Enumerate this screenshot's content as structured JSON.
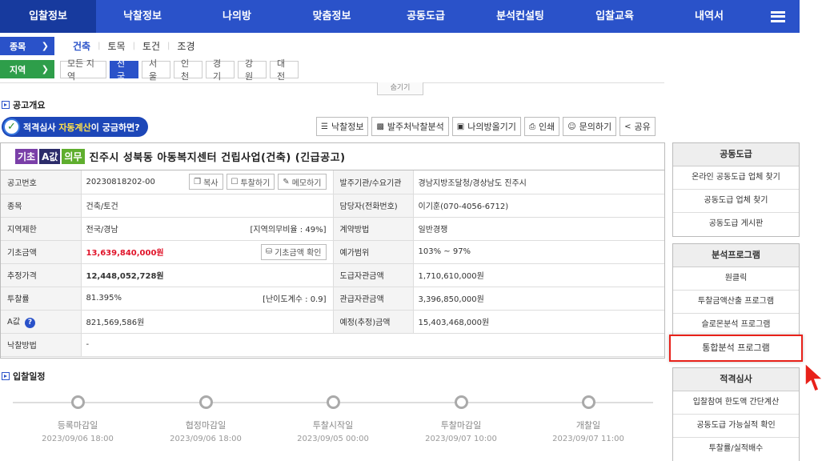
{
  "nav": {
    "items": [
      "입찰정보",
      "낙찰정보",
      "나의방",
      "맞춤정보",
      "공동도급",
      "분석컨설팅",
      "입찰교육",
      "내역서"
    ],
    "menu_icon": "hamburger-icon"
  },
  "filters": {
    "category_label": "종목",
    "categories": [
      "건축",
      "토목",
      "토건",
      "조경"
    ],
    "region_label": "지역",
    "regions": [
      "모든 지역",
      "전국",
      "서울",
      "인천",
      "경기",
      "강원",
      "대전"
    ],
    "hide_label": "숨기기"
  },
  "overview": {
    "title": "공고개요",
    "check_badge": {
      "before": "적격심사 ",
      "highlight": "자동계산",
      "after": "이 궁금하면?"
    },
    "tools": [
      "낙찰정보",
      "발주처낙찰분석",
      "나의방올기기",
      "인쇄",
      "문의하기",
      "공유"
    ]
  },
  "notice": {
    "tags": [
      {
        "text": "기초",
        "color": "#7a3fa8"
      },
      {
        "text": "A값",
        "color": "#2c2c6a"
      },
      {
        "text": "의무",
        "color": "#5fae2e"
      }
    ],
    "title": "진주시 성북동 아동복지센터 건립사업(건축) (긴급공고)",
    "fields": {
      "notice_no_label": "공고번호",
      "notice_no": "20230818202-00",
      "copy_btn": "복사",
      "bid_btn": "투찰하기",
      "memo_btn": "메모하기",
      "agency_label": "발주기관/수요기관",
      "agency": "경남지방조달청/경상남도 진주시",
      "category_label": "종목",
      "category": "건축/토건",
      "contact_label": "담당자(전화번호)",
      "contact": "이기훈(070-4056-6712)",
      "region_label": "지역제한",
      "region": "전국/경남",
      "region_ratio": "[지역의무비율 : 49%]",
      "contract_label": "계약방법",
      "contract": "일반경쟁",
      "base_label": "기초금액",
      "base": "13,639,840,000원",
      "base_btn": "기초금액 확인",
      "range_label": "예가범위",
      "range": "103% ~ 97%",
      "est_label": "추정가격",
      "est": "12,448,052,728원",
      "subcon_label": "도급자관금액",
      "subcon": "1,710,610,000원",
      "rate_label": "투찰률",
      "rate": "81.395%",
      "difficulty": "[난이도계수 : 0.9]",
      "gov_label": "관급자관금액",
      "gov": "3,396,850,000원",
      "a_label": "A값",
      "a_value": "821,569,586원",
      "plan_label": "예정(추정)금액",
      "plan": "15,403,468,000원",
      "method_label": "낙찰방법",
      "method": "-"
    }
  },
  "schedule": {
    "title": "입찰일정",
    "steps": [
      {
        "name": "등록마감일",
        "date": "2023/09/06 18:00"
      },
      {
        "name": "협정마감일",
        "date": "2023/09/06 18:00"
      },
      {
        "name": "투찰시작일",
        "date": "2023/09/05 00:00"
      },
      {
        "name": "투찰마감일",
        "date": "2023/09/07 10:00"
      },
      {
        "name": "개찰일",
        "date": "2023/09/07 11:00"
      }
    ]
  },
  "side": {
    "joint": {
      "title": "공동도급",
      "items": [
        "온라인 공동도급 업체 찾기",
        "공동도급 업체 찾기",
        "공동도급 게시판"
      ]
    },
    "analysis": {
      "title": "분석프로그램",
      "items": [
        "원클릭",
        "투찰금액산출 프로그램",
        "슬로몬분석 프로그램"
      ],
      "highlight": "통합분석 프로그램"
    },
    "qual": {
      "title": "적격심사",
      "items": [
        "입찰참여 한도액 간단계산",
        "공동도급 가능실적 확인",
        "투찰률/실적배수"
      ]
    }
  }
}
